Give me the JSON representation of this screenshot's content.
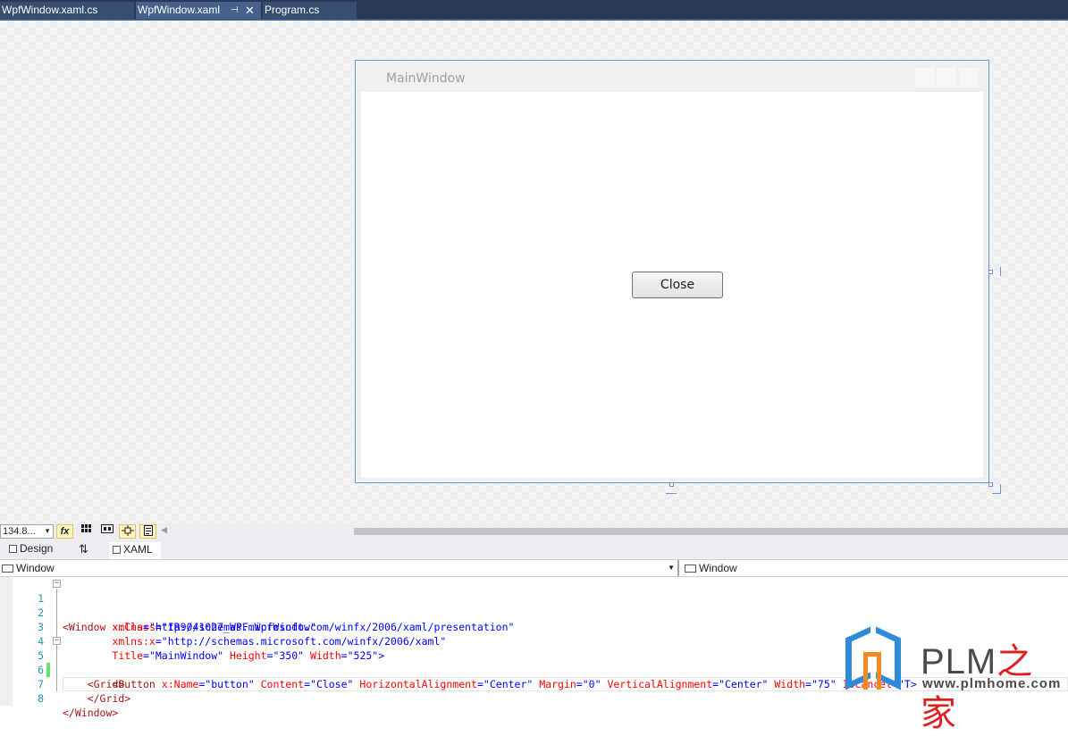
{
  "tabs": [
    {
      "label": "WpfWindow.xaml.cs"
    },
    {
      "label": "WpfWindow.xaml",
      "pin_glyph": "⊣",
      "close_glyph": "✕"
    },
    {
      "label": "Program.cs"
    }
  ],
  "designer": {
    "window_title": "MainWindow",
    "button_label": "Close"
  },
  "toolbar": {
    "zoom_value": "134.8...",
    "fx_label": "fx"
  },
  "split": {
    "design_label": "Design",
    "swap_glyph": "⇅",
    "xaml_label": "XAML"
  },
  "navigation": {
    "left_element": "Window",
    "right_element": "Window"
  },
  "code": {
    "line_numbers": [
      "1",
      "2",
      "3",
      "4",
      "5",
      "6",
      "7",
      "8"
    ],
    "l1_tag": "<Window",
    "l1_attr": "x:Class",
    "l1_eq": "=",
    "l1_val": "\"IR9041027_WPF.WpfWindow\"",
    "l2_attr": "xmlns",
    "l2_eq": "=",
    "l2_val": "\"http://schemas.microsoft.com/winfx/2006/xaml/presentation\"",
    "l3_attr": "xmlns:x",
    "l3_eq": "=",
    "l3_val": "\"http://schemas.microsoft.com/winfx/2006/xaml\"",
    "l4_attr1": "Title",
    "l4_val1": "\"MainWindow\"",
    "l4_attr2": "Height",
    "l4_val2": "\"350\"",
    "l4_attr3": "Width",
    "l4_val3": "\"525\"",
    "l4_end": ">",
    "l5_tag": "<Grid>",
    "l6_tag": "<Button",
    "l6_attr1": "x:Name",
    "l6_val1": "\"button\"",
    "l6_attr2": "Content",
    "l6_val2": "\"Close\"",
    "l6_attr3": "HorizontalAlignment",
    "l6_val3": "\"Center\"",
    "l6_attr4": "Margin",
    "l6_val4": "\"0\"",
    "l6_attr5": "VerticalAlignment",
    "l6_val5": "\"Center\"",
    "l6_attr6": "Width",
    "l6_val6": "\"75\"",
    "l6_attr7": "IsCancel",
    "l6_val7": "\"T",
    "l6_end": ">",
    "l7_tag": "</Grid>",
    "l8_tag": "</Window>"
  },
  "watermark": {
    "title": "PLM",
    "title_cn": "之家",
    "url": "www.plmhome.com"
  }
}
